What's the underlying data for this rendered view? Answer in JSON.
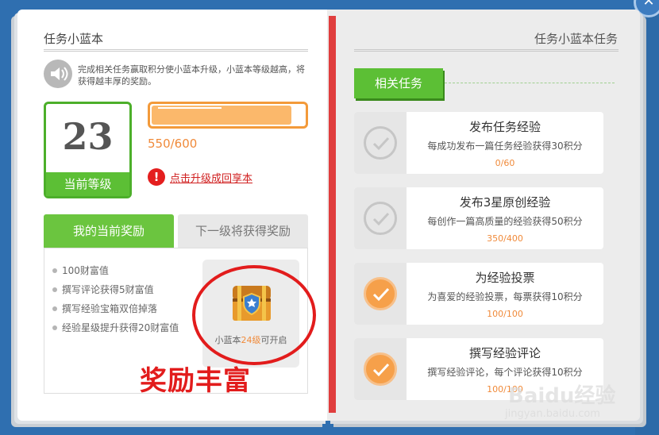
{
  "left": {
    "title": "任务小蓝本",
    "description": "完成相关任务赢取积分使小蓝本升级，小蓝本等级越高，将获得越丰厚的奖励。",
    "level": {
      "value": "23",
      "label": "当前等级"
    },
    "progress": {
      "text": "550/600",
      "fraction": 0.917
    },
    "upgrade_link": "点击升级成回享本",
    "tabs": {
      "current": "我的当前奖励",
      "next": "下一级将获得奖励"
    },
    "rewards": [
      "100财富值",
      "撰写评论获得5财富值",
      "撰写经验宝箱双倍掉落",
      "经验星级提升获得20财富值"
    ],
    "chest": {
      "caption_prefix": "小蓝本",
      "caption_level": "24级",
      "caption_suffix": "可开启"
    },
    "annotation": "奖励丰富"
  },
  "right": {
    "title": "任务小蓝本任务",
    "section_tag": "相关任务",
    "tasks": [
      {
        "title": "发布任务经验",
        "desc": "每成功发布一篇任务经验获得30积分",
        "progress": "0/60",
        "status": "pending"
      },
      {
        "title": "发布3星原创经验",
        "desc": "每创作一篇高质量的经验获得50积分",
        "progress": "350/400",
        "status": "pending"
      },
      {
        "title": "为经验投票",
        "desc": "为喜爱的经验投票，每票获得10积分",
        "progress": "100/100",
        "status": "done"
      },
      {
        "title": "撰写经验评论",
        "desc": "撰写经验评论，每个评论获得10积分",
        "progress": "100/100",
        "status": "done"
      }
    ]
  },
  "watermark": {
    "brand": "Baidu经验",
    "url": "jingyan.baidu.com"
  },
  "colors": {
    "green": "#5cbf35",
    "orange": "#f39a3a",
    "red": "#e21c1c",
    "blue": "#2f6fb0"
  }
}
